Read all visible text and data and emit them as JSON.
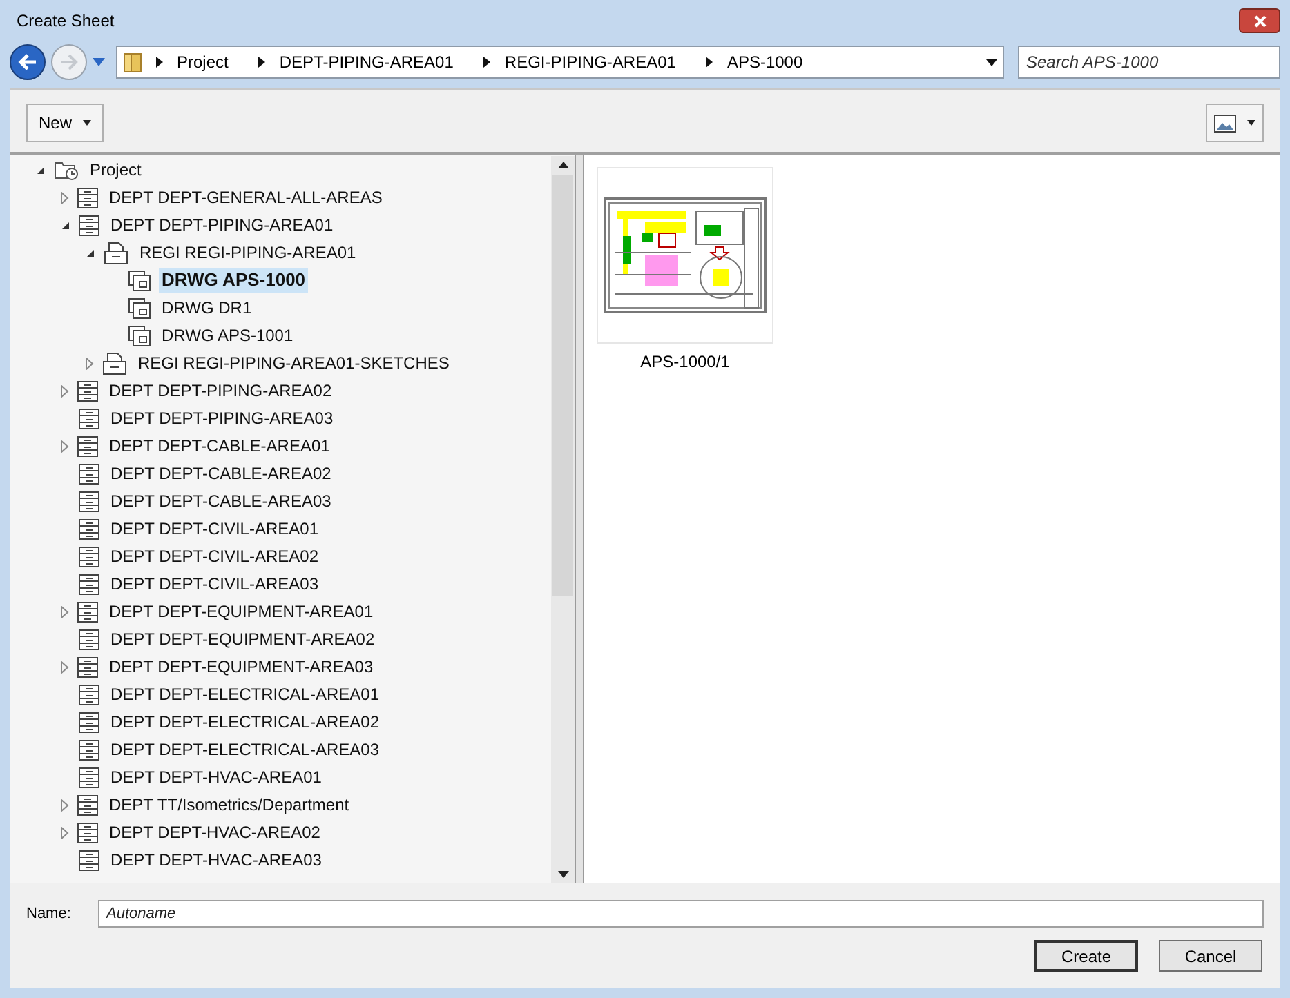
{
  "window": {
    "title": "Create Sheet"
  },
  "breadcrumb": [
    "Project",
    "DEPT-PIPING-AREA01",
    "REGI-PIPING-AREA01",
    "APS-1000"
  ],
  "search": {
    "placeholder": "Search APS-1000"
  },
  "toolbar": {
    "new_button": "New"
  },
  "tree": [
    {
      "kind": "project",
      "label": "Project",
      "expanded": true,
      "selected": false,
      "children": [
        {
          "kind": "dept",
          "label": "DEPT DEPT-GENERAL-ALL-AREAS",
          "expanded": false,
          "selected": false
        },
        {
          "kind": "dept",
          "label": "DEPT DEPT-PIPING-AREA01",
          "expanded": true,
          "selected": false,
          "children": [
            {
              "kind": "regi",
              "label": "REGI REGI-PIPING-AREA01",
              "expanded": true,
              "selected": false,
              "children": [
                {
                  "kind": "drwg",
                  "label": "DRWG APS-1000",
                  "selected": true
                },
                {
                  "kind": "drwg",
                  "label": "DRWG DR1",
                  "selected": false
                },
                {
                  "kind": "drwg",
                  "label": "DRWG APS-1001",
                  "selected": false
                }
              ]
            },
            {
              "kind": "regi",
              "label": "REGI REGI-PIPING-AREA01-SKETCHES",
              "expanded": false,
              "selected": false
            }
          ]
        },
        {
          "kind": "dept",
          "label": "DEPT DEPT-PIPING-AREA02",
          "expanded": false,
          "selected": false
        },
        {
          "kind": "dept",
          "label": "DEPT DEPT-PIPING-AREA03",
          "selected": false
        },
        {
          "kind": "dept",
          "label": "DEPT DEPT-CABLE-AREA01",
          "expanded": false,
          "selected": false
        },
        {
          "kind": "dept",
          "label": "DEPT DEPT-CABLE-AREA02",
          "selected": false
        },
        {
          "kind": "dept",
          "label": "DEPT DEPT-CABLE-AREA03",
          "selected": false
        },
        {
          "kind": "dept",
          "label": "DEPT DEPT-CIVIL-AREA01",
          "selected": false
        },
        {
          "kind": "dept",
          "label": "DEPT DEPT-CIVIL-AREA02",
          "selected": false
        },
        {
          "kind": "dept",
          "label": "DEPT DEPT-CIVIL-AREA03",
          "selected": false
        },
        {
          "kind": "dept",
          "label": "DEPT DEPT-EQUIPMENT-AREA01",
          "expanded": false,
          "selected": false
        },
        {
          "kind": "dept",
          "label": "DEPT DEPT-EQUIPMENT-AREA02",
          "selected": false
        },
        {
          "kind": "dept",
          "label": "DEPT DEPT-EQUIPMENT-AREA03",
          "expanded": false,
          "selected": false
        },
        {
          "kind": "dept",
          "label": "DEPT DEPT-ELECTRICAL-AREA01",
          "selected": false
        },
        {
          "kind": "dept",
          "label": "DEPT DEPT-ELECTRICAL-AREA02",
          "selected": false
        },
        {
          "kind": "dept",
          "label": "DEPT DEPT-ELECTRICAL-AREA03",
          "selected": false
        },
        {
          "kind": "dept",
          "label": "DEPT DEPT-HVAC-AREA01",
          "selected": false
        },
        {
          "kind": "dept",
          "label": "DEPT TT/Isometrics/Department",
          "expanded": false,
          "selected": false
        },
        {
          "kind": "dept",
          "label": "DEPT DEPT-HVAC-AREA02",
          "expanded": false,
          "selected": false
        },
        {
          "kind": "dept",
          "label": "DEPT DEPT-HVAC-AREA03",
          "selected": false
        }
      ]
    }
  ],
  "sheets": [
    {
      "label": "APS-1000/1",
      "selected": false
    }
  ],
  "name_field": {
    "label": "Name:",
    "placeholder": "Autoname"
  },
  "buttons": [
    {
      "label": "Create",
      "kind": "default"
    },
    {
      "label": "Cancel",
      "kind": "normal"
    }
  ]
}
